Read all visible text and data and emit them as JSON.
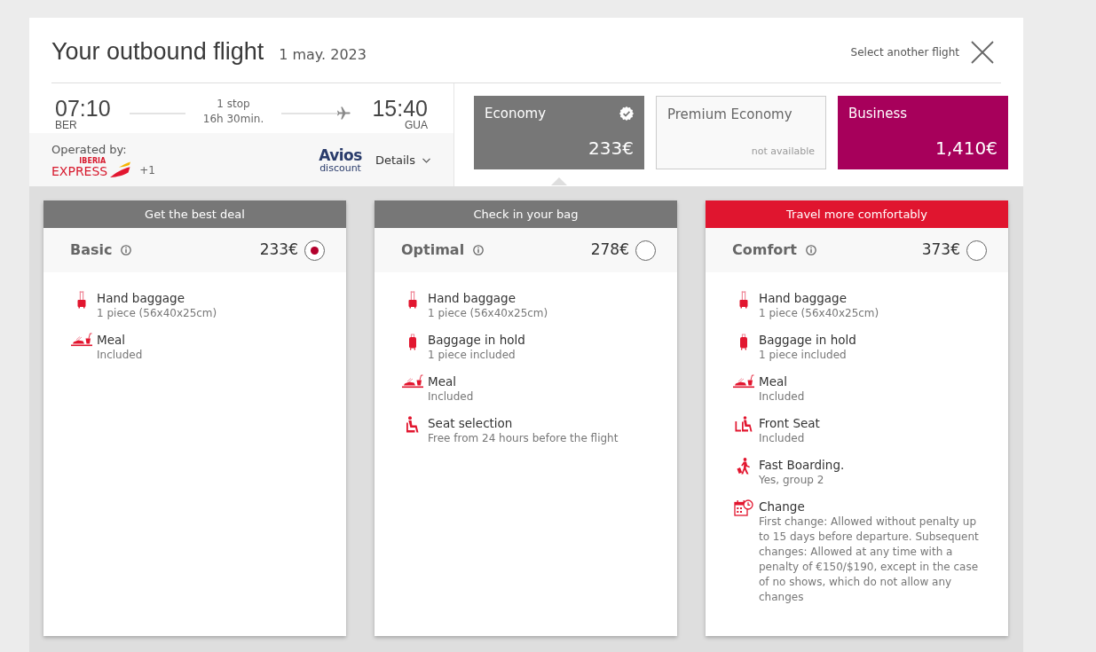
{
  "header": {
    "title": "Your outbound flight",
    "date": "1 may. 2023",
    "select_another_flight": "Select another flight"
  },
  "flight": {
    "departure": {
      "time": "07:10",
      "airport": "BER"
    },
    "stops": "1 stop",
    "duration": "16h 30min.",
    "arrival": {
      "time": "15:40",
      "airport": "GUA"
    },
    "operated_by": "Operated by:",
    "airline_logo": {
      "brand": "IBERIA",
      "name": "EXPRESS"
    },
    "more_airlines": "+1",
    "avios_badge": {
      "name": "Avios",
      "caption": "discount"
    },
    "details": "Details"
  },
  "cabins": [
    {
      "name": "Economy",
      "price": "233€",
      "selected": true,
      "available": true,
      "color": "#777777"
    },
    {
      "name": "Premium Economy",
      "note": "not available",
      "selected": false,
      "available": false
    },
    {
      "name": "Business",
      "price": "1,410€",
      "selected": false,
      "available": true,
      "color": "#a7005b"
    }
  ],
  "fares": [
    {
      "banner": "Get the best deal",
      "color": "#777777",
      "name": "Basic",
      "price": "233€",
      "selected": true,
      "features": [
        {
          "kind": "hand-baggage",
          "title": "Hand baggage",
          "detail": "1 piece (56x40x25cm)"
        },
        {
          "kind": "meal",
          "title": "Meal",
          "detail": "Included"
        }
      ]
    },
    {
      "banner": "Check in your bag",
      "color": "#777777",
      "name": "Optimal",
      "price": "278€",
      "selected": false,
      "features": [
        {
          "kind": "hand-baggage",
          "title": "Hand baggage",
          "detail": "1 piece (56x40x25cm)"
        },
        {
          "kind": "hold-baggage",
          "title": "Baggage in hold",
          "detail": "1 piece included"
        },
        {
          "kind": "meal",
          "title": "Meal",
          "detail": "Included"
        },
        {
          "kind": "seat",
          "title": "Seat selection",
          "detail": "Free from 24 hours before the flight"
        }
      ]
    },
    {
      "banner": "Travel more comfortably",
      "color": "#e0152f",
      "name": "Comfort",
      "price": "373€",
      "selected": false,
      "features": [
        {
          "kind": "hand-baggage",
          "title": "Hand baggage",
          "detail": "1 piece (56x40x25cm)"
        },
        {
          "kind": "hold-baggage",
          "title": "Baggage in hold",
          "detail": "1 piece included"
        },
        {
          "kind": "meal",
          "title": "Meal",
          "detail": "Included"
        },
        {
          "kind": "front-seat",
          "title": "Front Seat",
          "detail": "Included"
        },
        {
          "kind": "fast-boarding",
          "title": "Fast Boarding.",
          "detail": "Yes, group 2"
        },
        {
          "kind": "change",
          "title": "Change",
          "detail": "First change: Allowed without penalty up to 15 days before departure. Subsequent changes: Allowed at any time with a penalty of €150/$190, except in the case of no shows, which do not allow any changes"
        }
      ]
    }
  ]
}
